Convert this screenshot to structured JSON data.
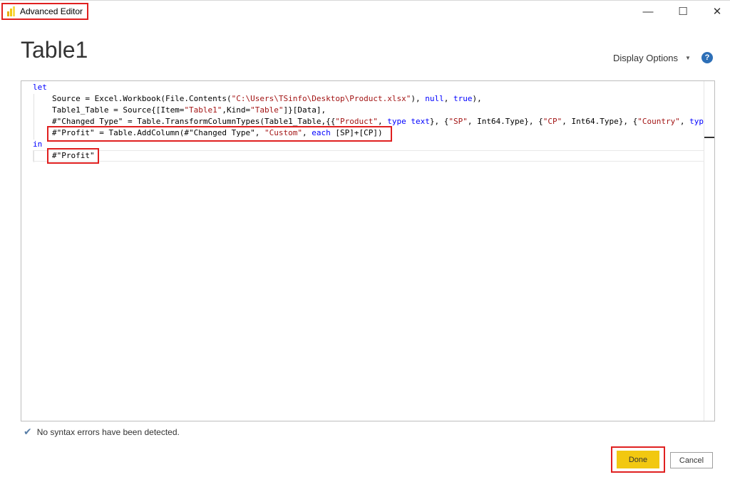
{
  "window": {
    "title": "Advanced Editor",
    "minimize": "—",
    "maximize": "☐",
    "close": "✕"
  },
  "header": {
    "query_name": "Table1",
    "display_options": "Display Options",
    "help": "?"
  },
  "code": {
    "l1": {
      "k": "let"
    },
    "l2": {
      "a": "Source = Excel.Workbook(File.Contents(",
      "s1": "\"C:\\Users\\TSinfo\\Desktop\\Product.xlsx\"",
      "b": "), ",
      "k1": "null",
      "c": ", ",
      "k2": "true",
      "d": "),"
    },
    "l3": {
      "a": "Table1_Table = Source{[Item=",
      "s1": "\"Table1\"",
      "b": ",Kind=",
      "s2": "\"Table\"",
      "c": "]}[Data],"
    },
    "l4": {
      "a": "#\"Changed Type\" = Table.TransformColumnTypes(Table1_Table,{{",
      "s1": "\"Product\"",
      "b": ", ",
      "k1": "type text",
      "c": "}, {",
      "s2": "\"SP\"",
      "d": ", Int64.Type}, {",
      "s3": "\"CP\"",
      "e": ", Int64.Type}, {",
      "s4": "\"Country\"",
      "f": ", ",
      "k2": "typ"
    },
    "l5": {
      "a": "#\"Profit\" = Table.AddColumn(#\"Changed Type\", ",
      "s1": "\"Custom\"",
      "b": ", ",
      "k1": "each",
      "c": " [SP]+[CP])"
    },
    "l6": {
      "k": "in"
    },
    "l7": {
      "a": "#\"Profit\""
    }
  },
  "status": {
    "message": "No syntax errors have been detected."
  },
  "buttons": {
    "done": "Done",
    "cancel": "Cancel"
  }
}
